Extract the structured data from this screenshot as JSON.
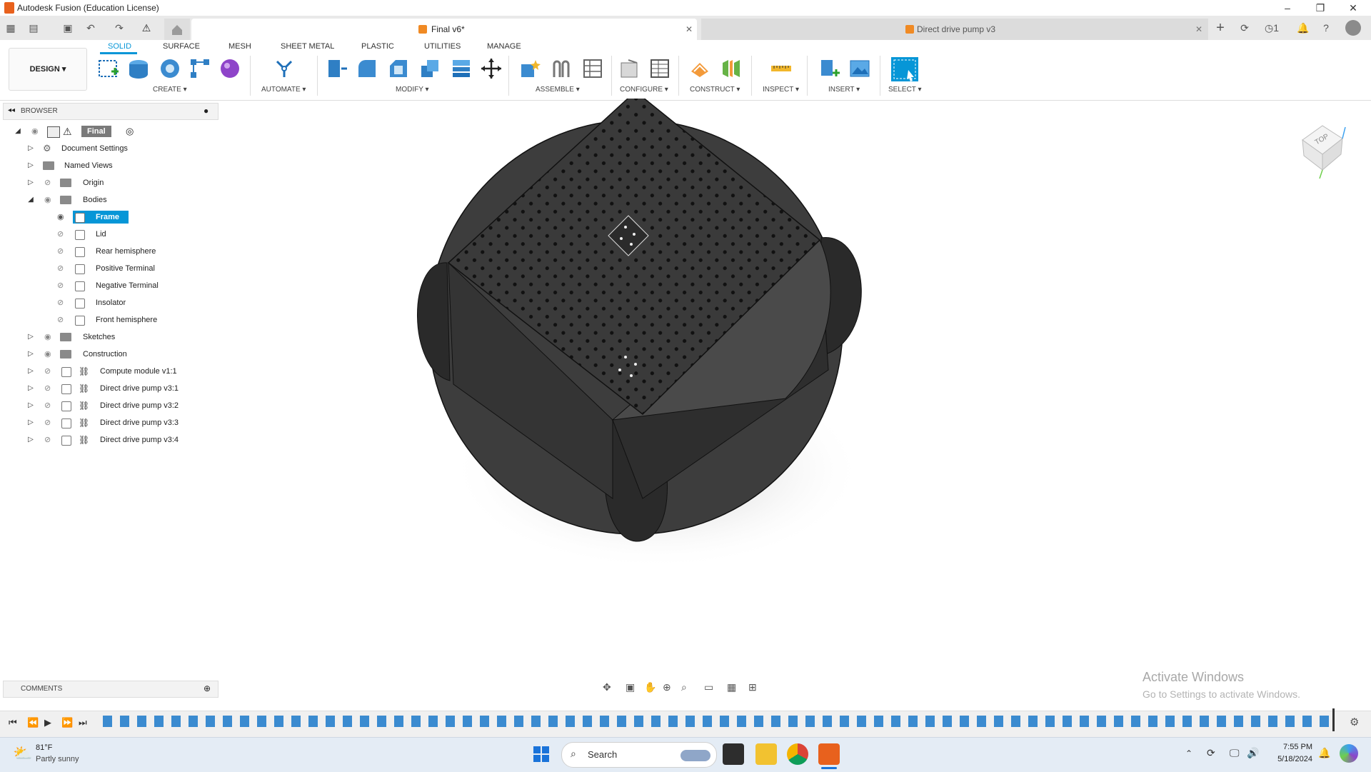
{
  "window": {
    "title": "Autodesk Fusion (Education License)",
    "controls": [
      "–",
      "❐",
      "✕"
    ]
  },
  "tabs": {
    "active_label": "Final v6*",
    "inactive_label": "Direct drive pump v3",
    "notification_count": "1",
    "close_glyph": "✕",
    "new_tab_glyph": "+"
  },
  "ribbon": {
    "workspace_label": "DESIGN ▾",
    "tabs": [
      "SOLID",
      "SURFACE",
      "MESH",
      "SHEET METAL",
      "PLASTIC",
      "UTILITIES",
      "MANAGE"
    ],
    "groups": [
      "CREATE ▾",
      "AUTOMATE ▾",
      "MODIFY ▾",
      "ASSEMBLE ▾",
      "CONFIGURE ▾",
      "CONSTRUCT ▾",
      "INSPECT ▾",
      "INSERT ▾",
      "SELECT ▾"
    ],
    "accent": "#0696d7"
  },
  "browser": {
    "header": "BROWSER",
    "root_label": "Final v6",
    "items": [
      {
        "label": "Document Settings"
      },
      {
        "label": "Named Views"
      },
      {
        "label": "Origin"
      },
      {
        "label": "Bodies"
      },
      {
        "label": "Frame"
      },
      {
        "label": "Lid"
      },
      {
        "label": "Rear hemisphere"
      },
      {
        "label": "Positive Terminal"
      },
      {
        "label": "Negative Terminal"
      },
      {
        "label": "Insolator"
      },
      {
        "label": "Front hemisphere"
      },
      {
        "label": "Sketches"
      },
      {
        "label": "Construction"
      },
      {
        "label": "Compute module v1:1"
      },
      {
        "label": "Direct drive pump v3:1"
      },
      {
        "label": "Direct drive pump v3:2"
      },
      {
        "label": "Direct drive pump v3:3"
      },
      {
        "label": "Direct drive pump v3:4"
      }
    ]
  },
  "comments": {
    "label": "COMMENTS"
  },
  "viewcube": {
    "face_label": "TOP"
  },
  "watermark": {
    "line1": "Activate Windows",
    "line2": "Go to Settings to activate Windows."
  },
  "taskbar": {
    "weather_temp": "81°F",
    "weather_desc": "Partly sunny",
    "search_placeholder": "Search",
    "time": "7:55 PM",
    "date": "5/18/2024"
  }
}
